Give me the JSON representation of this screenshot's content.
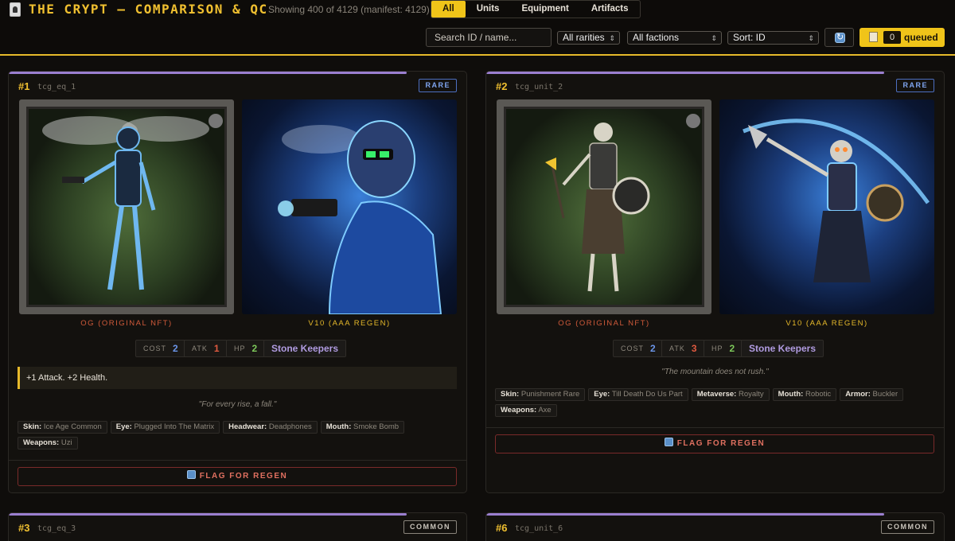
{
  "header": {
    "title": "THE CRYPT — COMPARISON & QC",
    "showing": "Showing 400 of 4129 (manifest: 4129)",
    "tabs": [
      {
        "label": "All",
        "active": true
      },
      {
        "label": "Units",
        "active": false
      },
      {
        "label": "Equipment",
        "active": false
      },
      {
        "label": "Artifacts",
        "active": false
      }
    ],
    "search_placeholder": "Search ID / name...",
    "filters": {
      "rarity": "All rarities",
      "faction": "All factions",
      "sort": "Sort: ID"
    },
    "queued_count": "0",
    "queued_label": "queued"
  },
  "cards": [
    {
      "num": "#1",
      "id": "tcg_eq_1",
      "rarity": "RARE",
      "og_label": "OG (ORIGINAL NFT)",
      "v10_label": "V10 (AAA REGEN)",
      "stats": {
        "cost_label": "COST",
        "cost": "2",
        "atk_label": "ATK",
        "atk": "1",
        "hp_label": "HP",
        "hp": "2"
      },
      "faction": "Stone Keepers",
      "ability": "+1 Attack. +2 Health.",
      "flavor": "\"For every rise, a fall.\"",
      "traits": [
        {
          "k": "Skin:",
          "v": "Ice Age Common"
        },
        {
          "k": "Eye:",
          "v": "Plugged Into The Matrix"
        },
        {
          "k": "Headwear:",
          "v": "Deadphones"
        },
        {
          "k": "Mouth:",
          "v": "Smoke Bomb"
        },
        {
          "k": "Weapons:",
          "v": "Uzi"
        }
      ],
      "flag_label": "FLAG FOR REGEN"
    },
    {
      "num": "#2",
      "id": "tcg_unit_2",
      "rarity": "RARE",
      "og_label": "OG (ORIGINAL NFT)",
      "v10_label": "V10 (AAA REGEN)",
      "stats": {
        "cost_label": "COST",
        "cost": "2",
        "atk_label": "ATK",
        "atk": "3",
        "hp_label": "HP",
        "hp": "2"
      },
      "faction": "Stone Keepers",
      "flavor": "\"The mountain does not rush.\"",
      "traits": [
        {
          "k": "Skin:",
          "v": "Punishment Rare"
        },
        {
          "k": "Eye:",
          "v": "Till Death Do Us Part"
        },
        {
          "k": "Metaverse:",
          "v": "Royalty"
        },
        {
          "k": "Mouth:",
          "v": "Robotic"
        },
        {
          "k": "Armor:",
          "v": "Buckler"
        },
        {
          "k": "Weapons:",
          "v": "Axe"
        }
      ],
      "flag_label": "FLAG FOR REGEN"
    },
    {
      "num": "#3",
      "id": "tcg_eq_3",
      "rarity": "COMMON"
    },
    {
      "num": "#6",
      "id": "tcg_unit_6",
      "rarity": "COMMON"
    }
  ]
}
